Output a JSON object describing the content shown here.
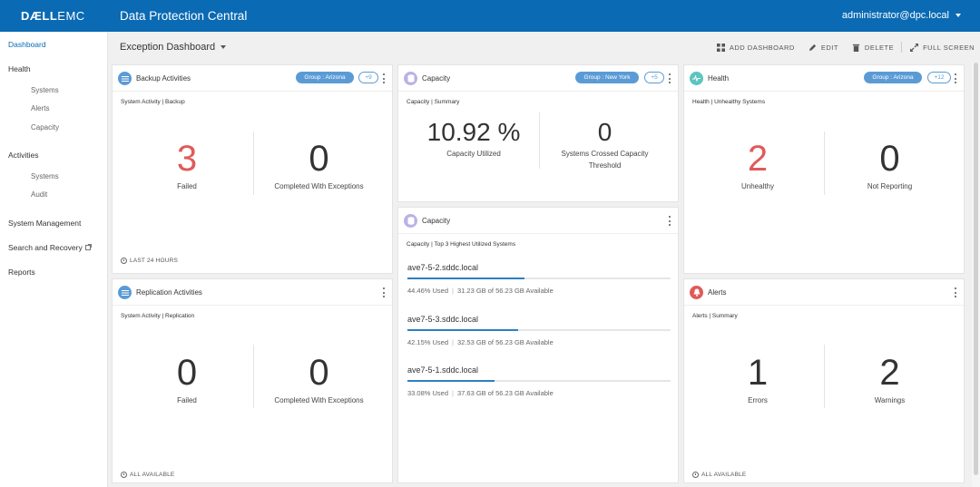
{
  "colors": {
    "brand_blue": "#0a6ab3",
    "pill_blue": "#5b9bd5",
    "alert_red": "#e05a5a",
    "bar_blue": "#2e7fbf"
  },
  "header": {
    "brand_bold": "DÆLL",
    "brand_light": "EMC",
    "app_title": "Data Protection Central",
    "user": "administrator@dpc.local"
  },
  "sidebar": {
    "dashboard": "Dashboard",
    "health": "Health",
    "health_items": [
      "Systems",
      "Alerts",
      "Capacity"
    ],
    "activities": "Activities",
    "activities_items": [
      "Systems",
      "Audit"
    ],
    "system_management": "System Management",
    "search_recovery": "Search and Recovery",
    "reports": "Reports"
  },
  "dashboard": {
    "title": "Exception Dashboard",
    "toolbar": {
      "add": "ADD DASHBOARD",
      "edit": "EDIT",
      "delete": "DELETE",
      "fullscreen": "FULL SCREEN"
    }
  },
  "cards": {
    "backup": {
      "title": "Backup Activities",
      "group": "Group : Arizona",
      "count": "+9",
      "subtitle": "System Activity | Backup",
      "metrics": [
        {
          "value": "3",
          "label": "Failed"
        },
        {
          "value": "0",
          "label": "Completed With Exceptions"
        }
      ],
      "footer": "LAST 24 HOURS"
    },
    "replication": {
      "title": "Replication Activities",
      "subtitle": "System Activity | Replication",
      "metrics": [
        {
          "value": "0",
          "label": "Failed"
        },
        {
          "value": "0",
          "label": "Completed With Exceptions"
        }
      ],
      "footer": "ALL AVAILABLE"
    },
    "capacity_summary": {
      "title": "Capacity",
      "group": "Group : New York",
      "count": "+5",
      "subtitle": "Capacity | Summary",
      "metrics": [
        {
          "value": "10.92 %",
          "label": "Capacity Utilized"
        },
        {
          "value": "0",
          "label": "Systems Crossed Capacity",
          "label2": "Threshold"
        }
      ]
    },
    "capacity_top": {
      "title": "Capacity",
      "subtitle": "Capacity | Top 3 Highest Utilized Systems",
      "systems": [
        {
          "name": "ave7-5-2.sddc.local",
          "used_pct": 44.46,
          "used": "44.46% Used",
          "available": "31.23 GB of 56.23 GB Available"
        },
        {
          "name": "ave7-5-3.sddc.local",
          "used_pct": 42.15,
          "used": "42.15% Used",
          "available": "32.53 GB of 56.23 GB Available"
        },
        {
          "name": "ave7-5-1.sddc.local",
          "used_pct": 33.08,
          "used": "33.08% Used",
          "available": "37.63 GB of 56.23 GB Available"
        }
      ]
    },
    "health": {
      "title": "Health",
      "group": "Group : Arizona",
      "count": "+12",
      "subtitle": "Health | Unhealthy Systems",
      "metrics": [
        {
          "value": "2",
          "label": "Unhealthy"
        },
        {
          "value": "0",
          "label": "Not Reporting"
        }
      ]
    },
    "alerts": {
      "title": "Alerts",
      "subtitle": "Alerts | Summary",
      "metrics": [
        {
          "value": "1",
          "label": "Errors"
        },
        {
          "value": "2",
          "label": "Warnings"
        }
      ],
      "footer": "ALL AVAILABLE"
    }
  }
}
